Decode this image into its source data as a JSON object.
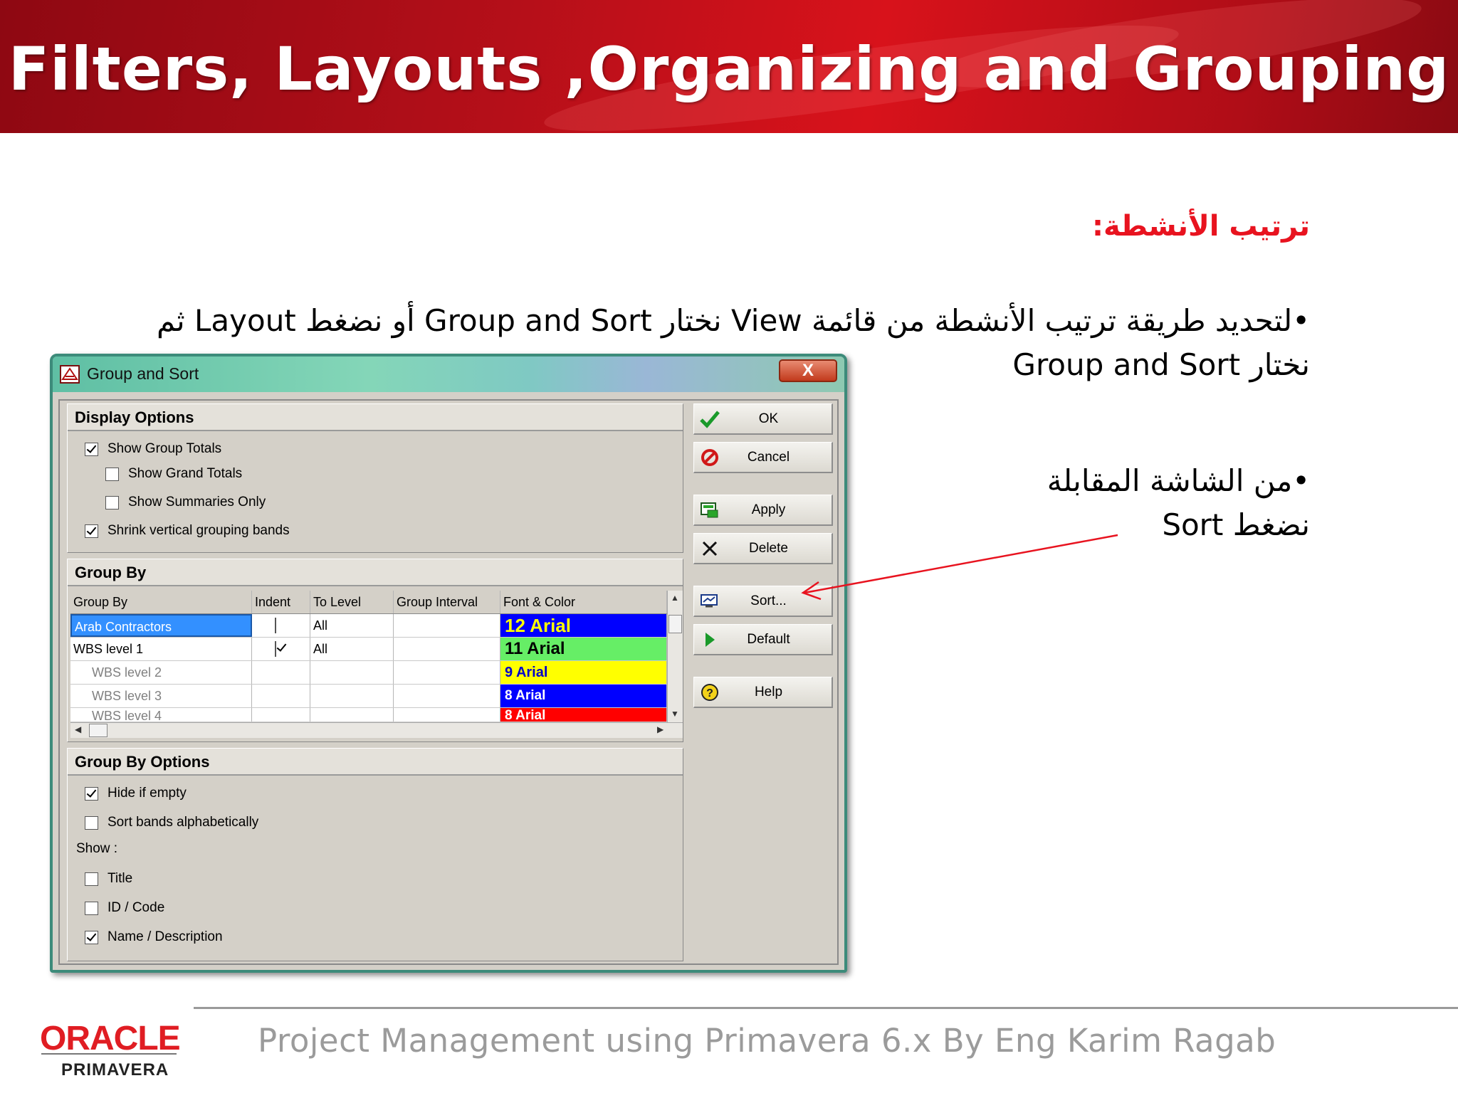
{
  "slide": {
    "title": "Filters, Layouts ,Organizing and Grouping",
    "arabic_heading": "ترتيب الأنشطة:",
    "arabic_bullet_1": "•لتحديد طريقة ترتيب الأنشطة من قائمة View نختار Group and Sort أو نضغط  Layout ثم نختار Group and Sort",
    "arabic_bullet_2": "•من الشاشة المقابلة نضغط    Sort"
  },
  "dialog": {
    "title": "Group and Sort",
    "close_label": "X",
    "display_options": {
      "header": "Display Options",
      "items": [
        {
          "label": "Show Group Totals",
          "checked": true
        },
        {
          "label": "Show Grand Totals",
          "checked": false
        },
        {
          "label": "Show Summaries Only",
          "checked": false
        },
        {
          "label": "Shrink vertical grouping bands",
          "checked": true
        }
      ]
    },
    "group_by": {
      "header": "Group By",
      "columns": [
        "Group By",
        "Indent",
        "To Level",
        "Group Interval",
        "Font & Color"
      ],
      "rows": [
        {
          "group_by": "Arab Contractors",
          "indent": false,
          "to_level": "All",
          "group_interval": "",
          "font": "12 Arial",
          "bg": "#0000ff",
          "fg": "#ffff00"
        },
        {
          "group_by": "WBS level 1",
          "indent": true,
          "to_level": "All",
          "group_interval": "",
          "font": "11 Arial",
          "bg": "#66ee66",
          "fg": "#000000"
        },
        {
          "group_by": "WBS level 2",
          "indent": null,
          "to_level": "",
          "group_interval": "",
          "font": "9 Arial",
          "bg": "#ffff00",
          "fg": "#0000cc"
        },
        {
          "group_by": "WBS level 3",
          "indent": null,
          "to_level": "",
          "group_interval": "",
          "font": "8 Arial",
          "bg": "#0000ff",
          "fg": "#ffffff"
        },
        {
          "group_by": "WBS level 4",
          "indent": null,
          "to_level": "",
          "group_interval": "",
          "font": "8 Arial",
          "bg": "#ff0000",
          "fg": "#ffffff"
        }
      ]
    },
    "group_by_options": {
      "header": "Group By Options",
      "hide_if_empty": "Hide if empty",
      "sort_bands": "Sort bands alphabetically",
      "show_label": "Show :",
      "show_items": [
        {
          "label": "Title",
          "checked": false
        },
        {
          "label": "ID / Code",
          "checked": false
        },
        {
          "label": "Name / Description",
          "checked": true
        }
      ]
    },
    "buttons": {
      "ok": "OK",
      "cancel": "Cancel",
      "apply": "Apply",
      "delete": "Delete",
      "sort": "Sort...",
      "default": "Default",
      "help": "Help"
    }
  },
  "footer": {
    "oracle": "ORACLE",
    "primavera": "PRIMAVERA",
    "text": "Project Management using Primavera 6.x By Eng Karim Ragab"
  },
  "colors": {
    "header_red": "#c8101a",
    "arabic_heading": "#e8131f",
    "arrow": "#e8131f",
    "selection": "#3390ff"
  }
}
